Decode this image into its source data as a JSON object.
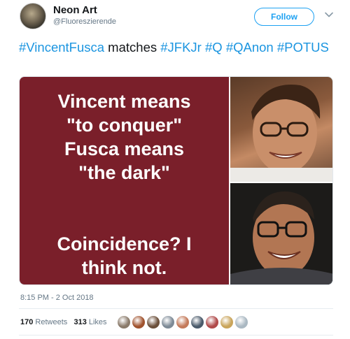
{
  "tweet": {
    "display_name": "Neon Art",
    "handle": "@Fluoreszierende",
    "follow_label": "Follow",
    "text_parts": [
      {
        "text": "#VincentFusca",
        "tag": true
      },
      {
        "text": " matches ",
        "tag": false
      },
      {
        "text": "#JFKJr",
        "tag": true
      },
      {
        "text": " ",
        "tag": false
      },
      {
        "text": "#Q",
        "tag": true
      },
      {
        "text": " ",
        "tag": false
      },
      {
        "text": "#QAnon",
        "tag": true
      },
      {
        "text": " ",
        "tag": false
      },
      {
        "text": "#POTUS",
        "tag": true
      }
    ],
    "timestamp": "8:15 PM - 2 Oct 2018",
    "retweets_count": "170",
    "retweets_label": "Retweets",
    "likes_count": "313",
    "likes_label": "Likes"
  },
  "meme": {
    "lines_top": [
      "Vincent means",
      "\"to conquer\"",
      "Fusca means",
      "\"the dark\""
    ],
    "lines_bottom": [
      "Coincidence? I",
      "think not."
    ],
    "background_color": "#7a1f2a"
  },
  "colors": {
    "link": "#1b95e0",
    "follow": "#1da1f2",
    "secondary_text": "#657786"
  },
  "likers": [
    {
      "icon": "liker-avatar-1",
      "color": "#8a7a6a"
    },
    {
      "icon": "liker-avatar-2",
      "color": "#a0522d"
    },
    {
      "icon": "liker-avatar-3",
      "color": "#6b4f3a"
    },
    {
      "icon": "liker-avatar-4",
      "color": "#7d8a96"
    },
    {
      "icon": "liker-avatar-5",
      "color": "#c47a5a"
    },
    {
      "icon": "liker-avatar-6",
      "color": "#4a5a6a"
    },
    {
      "icon": "liker-avatar-7",
      "color": "#b04a4a"
    },
    {
      "icon": "liker-avatar-8",
      "color": "#c9a45a"
    },
    {
      "icon": "liker-avatar-9",
      "color": "#aab8c2"
    }
  ]
}
